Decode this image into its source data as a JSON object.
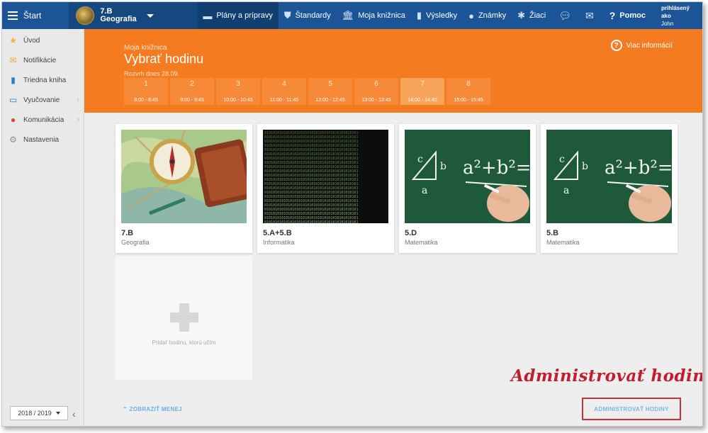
{
  "topbar": {
    "start_label": "Štart",
    "class_name": "7.B",
    "class_subject": "Geografia",
    "nav": [
      {
        "label": "Plány a prípravy",
        "icon": "briefcase-icon",
        "glyph": "▬",
        "active": true
      },
      {
        "label": "Štandardy",
        "icon": "shield-icon",
        "glyph": "⛊",
        "active": false
      },
      {
        "label": "Moja knižnica",
        "icon": "library-icon",
        "glyph": "🏛",
        "active": false
      },
      {
        "label": "Výsledky",
        "icon": "bar-chart-icon",
        "glyph": "▮",
        "active": false
      },
      {
        "label": "Známky",
        "icon": "grades-icon",
        "glyph": "●",
        "active": false
      },
      {
        "label": "Žiaci",
        "icon": "students-icon",
        "glyph": "✱",
        "active": false
      }
    ],
    "help_label": "Pomoc",
    "user_caption": "Ste prihlásený ako",
    "user_name": "John Williams"
  },
  "sidebar": {
    "items": [
      {
        "label": "Úvod",
        "icon": "star-icon",
        "glyph": "★",
        "color": "#f2b531",
        "chevron": false
      },
      {
        "label": "Notifikácie",
        "icon": "envelope-icon",
        "glyph": "✉",
        "color": "#f0a53b",
        "chevron": false
      },
      {
        "label": "Triedna kniha",
        "icon": "book-icon",
        "glyph": "▮",
        "color": "#2a7bc8",
        "chevron": false
      },
      {
        "label": "Vyučovanie",
        "icon": "open-book-icon",
        "glyph": "▭",
        "color": "#2a7bc8",
        "chevron": true
      },
      {
        "label": "Komunikácia",
        "icon": "chat-icon",
        "glyph": "●",
        "color": "#d9433a",
        "chevron": true
      },
      {
        "label": "Nastavenia",
        "icon": "gear-icon",
        "glyph": "⚙",
        "color": "#8e8e8e",
        "chevron": false
      }
    ],
    "school_year": "2018 / 2019"
  },
  "hero": {
    "breadcrumb": "Moja knižnica",
    "title": "Vybrať hodinu",
    "schedule_label": "Rozvrh dnes 28.09.",
    "more_info": "Viac informácií",
    "slots": [
      {
        "n": "1",
        "time": "8:00 - 8:45"
      },
      {
        "n": "2",
        "time": "9:00 - 9:45"
      },
      {
        "n": "3",
        "time": "10:00 - 10:45"
      },
      {
        "n": "4",
        "time": "11:00 - 11:45"
      },
      {
        "n": "5",
        "time": "12:00 - 12:45"
      },
      {
        "n": "6",
        "time": "13:00 - 13:45"
      },
      {
        "n": "7",
        "time": "14:00 - 14:45"
      },
      {
        "n": "8",
        "time": "15:00 - 15:45"
      }
    ],
    "selected_slot": "7"
  },
  "cards": [
    {
      "name": "7.B",
      "subject": "Geografia",
      "image": "compass-map"
    },
    {
      "name": "5.A+5.B",
      "subject": "Informatika",
      "image": "binary-code"
    },
    {
      "name": "5.D",
      "subject": "Matematika",
      "image": "chalkboard-pythagoras"
    },
    {
      "name": "5.B",
      "subject": "Matematika",
      "image": "chalkboard-pythagoras"
    }
  ],
  "add_card_label": "Pridať hodinu, ktorú učím",
  "show_less": "ZOBRAZIŤ MENEJ",
  "admin_button": "ADMINISTROVAŤ HODINY",
  "annotation": "Administrovať hodiny",
  "colors": {
    "topbar": "#1c5597",
    "accent_orange": "#f47b20",
    "annotation_red": "#c01e2e",
    "link_blue": "#6eaee3"
  }
}
